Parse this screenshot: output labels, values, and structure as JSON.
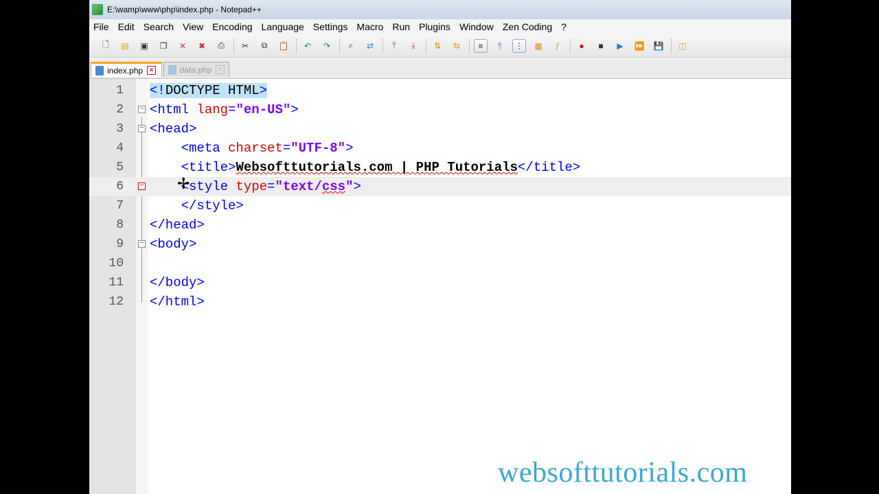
{
  "window": {
    "title": "E:\\wamp\\www\\php\\index.php - Notepad++"
  },
  "menu": [
    "File",
    "Edit",
    "Search",
    "View",
    "Encoding",
    "Language",
    "Settings",
    "Macro",
    "Run",
    "Plugins",
    "Window",
    "Zen Coding",
    "?"
  ],
  "toolbar": {
    "icons": [
      "new-file-icon",
      "open-file-icon",
      "save-icon",
      "save-all-icon",
      "close-icon",
      "close-all-icon",
      "print-icon",
      "cut-icon",
      "copy-icon",
      "paste-icon",
      "undo-icon",
      "redo-icon",
      "find-icon",
      "replace-icon",
      "zoom-in-icon",
      "zoom-out-icon",
      "sync-vertical-icon",
      "sync-horizontal-icon",
      "word-wrap-icon",
      "show-all-chars-icon",
      "indent-guide-icon",
      "doc-map-icon",
      "function-list-icon",
      "record-macro-icon",
      "stop-macro-icon",
      "play-macro-icon",
      "play-multiple-icon",
      "save-macro-icon",
      "launch-browser-icon"
    ]
  },
  "tabs": [
    {
      "label": "index.php",
      "active": true
    },
    {
      "label": "data.php",
      "active": false
    }
  ],
  "editor": {
    "current_line": 6,
    "lines": [
      {
        "num": "1"
      },
      {
        "num": "2"
      },
      {
        "num": "3"
      },
      {
        "num": "4"
      },
      {
        "num": "5"
      },
      {
        "num": "6"
      },
      {
        "num": "7"
      },
      {
        "num": "8"
      },
      {
        "num": "9"
      },
      {
        "num": "10"
      },
      {
        "num": "11"
      },
      {
        "num": "12"
      }
    ],
    "code": {
      "l1_a": "<!",
      "l1_b": "DOCTYPE HTML",
      "l1_c": ">",
      "l2_open": "<html",
      "l2_attr": " lang",
      "l2_eq": "=",
      "l2_val": "\"en-US\"",
      "l2_close": ">",
      "l3": "<head>",
      "l4_open": "<meta",
      "l4_attr": " charset",
      "l4_eq": "=",
      "l4_val": "\"UTF-8\"",
      "l4_close": ">",
      "l5_open": "<title>",
      "l5_text": "Websofttutorials.com | PHP Tutorials",
      "l5_close": "</title>",
      "l6_open": "<style",
      "l6_attr": " type",
      "l6_eq": "=",
      "l6_val1": "\"text/",
      "l6_val2": "css",
      "l6_val3": "\"",
      "l6_close": ">",
      "l7": "</style>",
      "l8": "</head>",
      "l9": "<body>",
      "l11": "</body>",
      "l12": "</html>"
    }
  },
  "watermark": "websofttutorials.com"
}
